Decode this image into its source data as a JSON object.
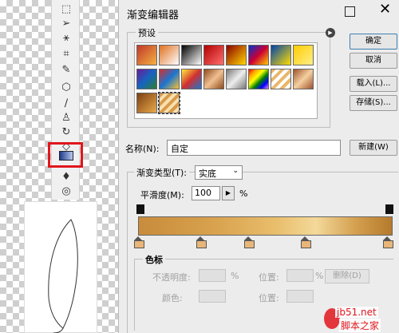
{
  "toolbox": {
    "tools": [
      "marquee-tool",
      "lasso-tool",
      "magic-wand-tool",
      "crop-tool",
      "eyedropper-tool",
      "healing-tool",
      "brush-tool",
      "stamp-tool",
      "history-brush-tool",
      "eraser-tool",
      "gradient-tool",
      "blur-tool",
      "dodge-tool"
    ]
  },
  "dialog": {
    "title": "渐变编辑器",
    "presets_label": "预设",
    "buttons": {
      "ok": "确定",
      "cancel": "取消",
      "load": "载入(L)...",
      "save": "存储(S)...",
      "new": "新建(W)"
    },
    "name_label": "名称(N):",
    "name_value": "自定",
    "gradient_type_label": "渐变类型(T):",
    "gradient_type_value": "实底",
    "smoothness_label": "平滑度(M):",
    "smoothness_value": "100",
    "smoothness_unit": "%",
    "stops": {
      "label": "色标",
      "opacity_label": "不透明度:",
      "opacity_unit": "%",
      "position_label": "位置:",
      "position_unit": "%",
      "delete_label": "删除(D)",
      "color_label": "颜色:"
    }
  },
  "colors": {
    "highlight": "#e0161d",
    "gradient_start": "#c88c3c",
    "gradient_mid": "#f3d99a",
    "gradient_end": "#b57a2c"
  },
  "watermark": {
    "url": "jb51.net",
    "site": "脚本之家"
  }
}
